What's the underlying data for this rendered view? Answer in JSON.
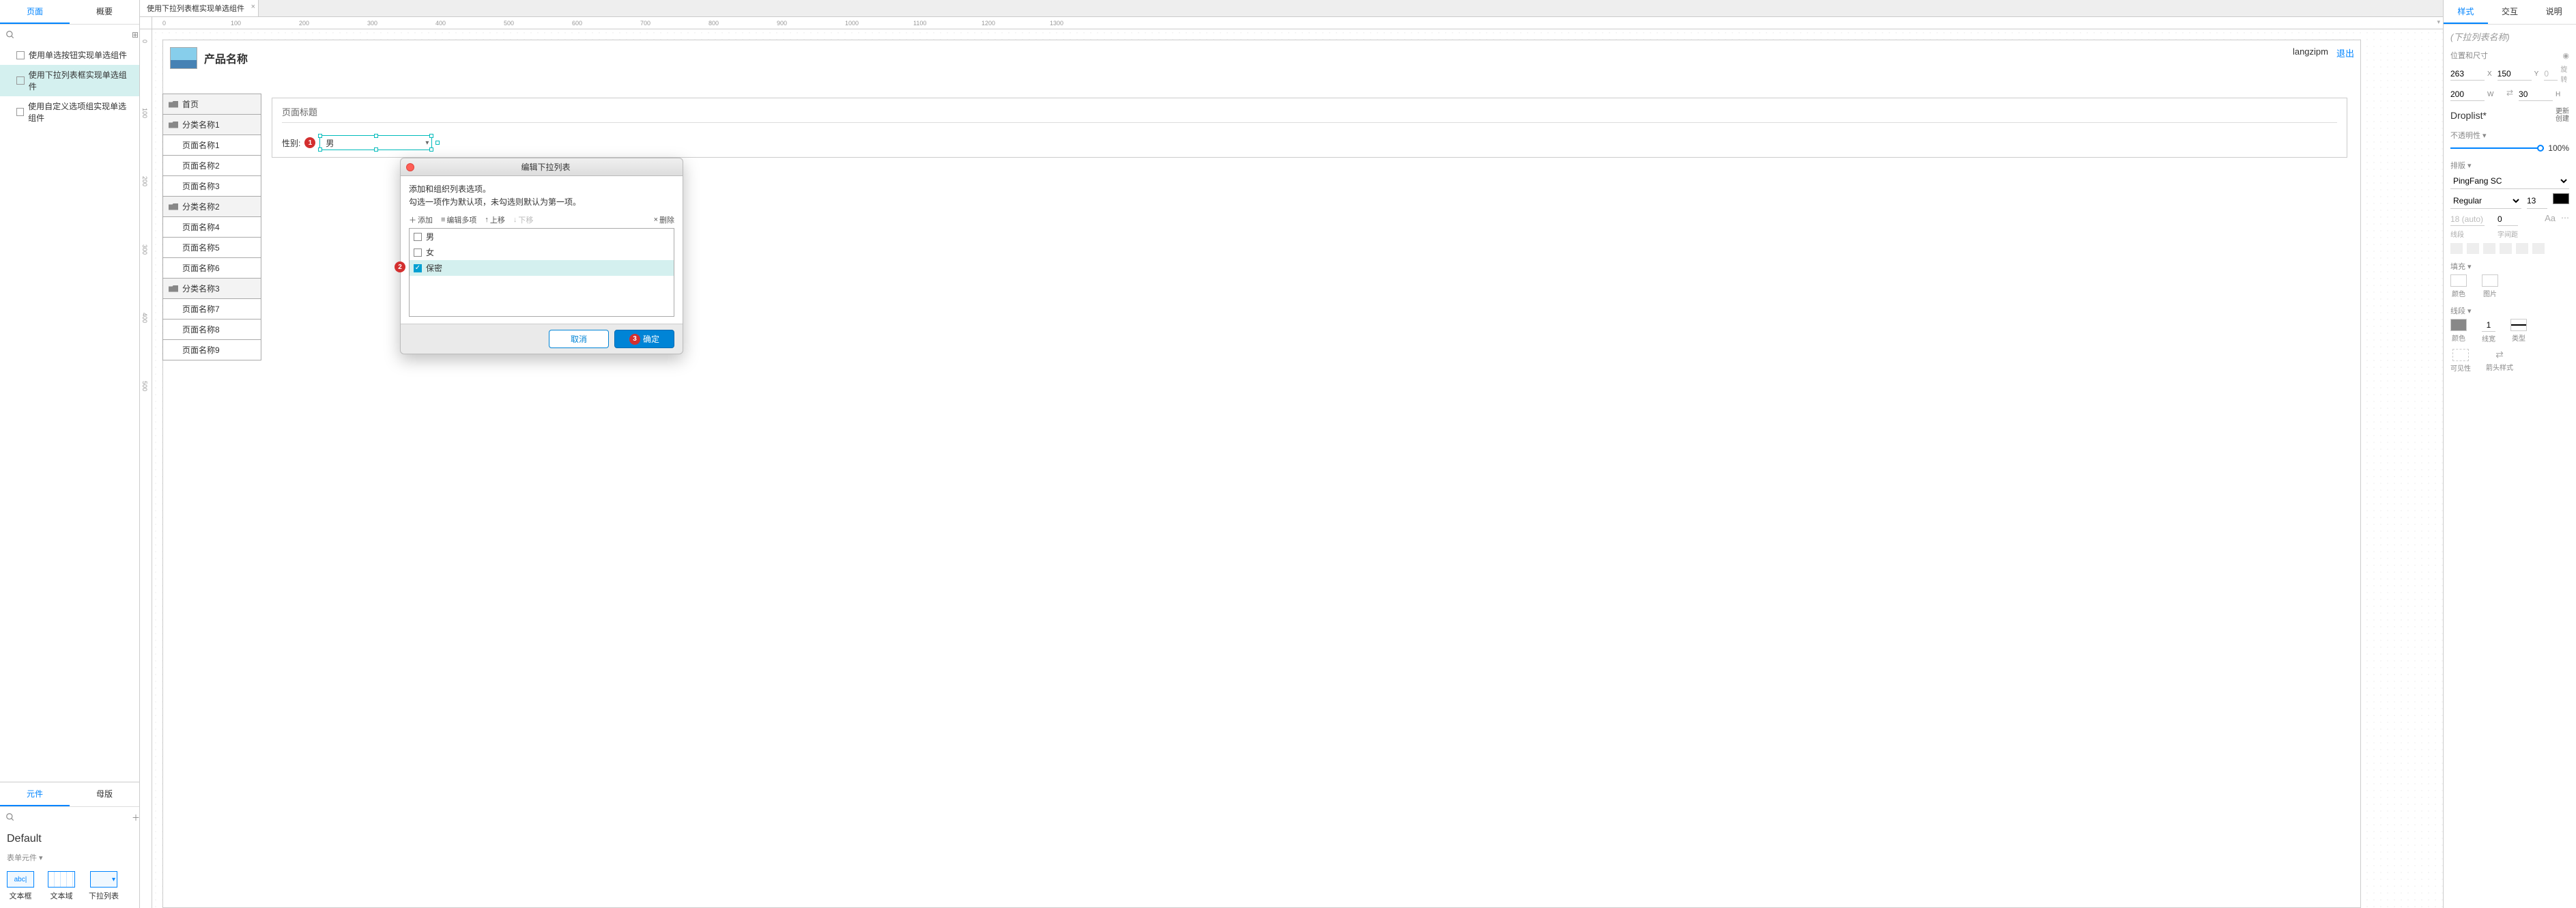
{
  "leftPanel": {
    "tabs": {
      "pages": "页面",
      "overview": "概要"
    },
    "tree": [
      {
        "label": "使用单选按钮实现单选组件",
        "selected": false
      },
      {
        "label": "使用下拉列表框实现单选组件",
        "selected": true
      },
      {
        "label": "使用自定义选项组实现单选组件",
        "selected": false
      }
    ]
  },
  "libPanel": {
    "tabs": {
      "widgets": "元件",
      "masters": "母版"
    },
    "defaultLabel": "Default",
    "categoryLabel": "表单元件 ▾",
    "widgets": [
      {
        "label": "文本框",
        "kind": "text"
      },
      {
        "label": "文本域",
        "kind": "grid"
      },
      {
        "label": "下拉列表",
        "kind": "drop"
      }
    ]
  },
  "centerTab": {
    "label": "使用下拉列表框实现单选组件"
  },
  "rulerH": [
    0,
    100,
    200,
    300,
    400,
    500,
    600,
    700,
    800,
    900,
    1000,
    1100,
    1200,
    1300
  ],
  "rulerV": [
    0,
    100,
    200,
    300,
    400,
    500
  ],
  "design": {
    "productTitle": "产品名称",
    "username": "langzipm",
    "logout": "退出",
    "sitemap": [
      {
        "label": "首页",
        "type": "cat"
      },
      {
        "label": "分类名称1",
        "type": "cat"
      },
      {
        "label": "页面名称1",
        "type": "sub"
      },
      {
        "label": "页面名称2",
        "type": "sub"
      },
      {
        "label": "页面名称3",
        "type": "sub"
      },
      {
        "label": "分类名称2",
        "type": "cat"
      },
      {
        "label": "页面名称4",
        "type": "sub"
      },
      {
        "label": "页面名称5",
        "type": "sub"
      },
      {
        "label": "页面名称6",
        "type": "sub"
      },
      {
        "label": "分类名称3",
        "type": "cat"
      },
      {
        "label": "页面名称7",
        "type": "sub"
      },
      {
        "label": "页面名称8",
        "type": "sub"
      },
      {
        "label": "页面名称9",
        "type": "sub"
      }
    ],
    "pageTitle": "页面标题",
    "fieldLabel": "性别:",
    "badge1": "1",
    "droplistValue": "男"
  },
  "dialog": {
    "title": "编辑下拉列表",
    "desc1": "添加和组织列表选项。",
    "desc2": "勾选一项作为默认项，未勾选则默认为第一项。",
    "tools": {
      "add": "添加",
      "editMany": "编辑多项",
      "up": "上移",
      "down": "下移",
      "del": "删除"
    },
    "items": [
      {
        "label": "男",
        "checked": false
      },
      {
        "label": "女",
        "checked": false
      },
      {
        "label": "保密",
        "checked": true,
        "selected": true
      }
    ],
    "badge2": "2",
    "cancel": "取消",
    "ok": "确定",
    "badge3": "3"
  },
  "rightPanel": {
    "tabs": {
      "style": "样式",
      "interact": "交互",
      "notes": "说明"
    },
    "namePlaceholder": "(下拉列表名称)",
    "posSizeLabel": "位置和尺寸",
    "x": "263",
    "xUnit": "X",
    "y": "150",
    "yUnit": "Y",
    "rotate": "0",
    "rotateUnit": "",
    "w": "200",
    "wUnit": "W",
    "h": "30",
    "hUnit": "H",
    "widgetType": "Droplist*",
    "updateCreate1": "更新",
    "updateCreate2": "创建",
    "opacityLabel": "不透明性 ▾",
    "opacityVal": "100%",
    "typographyLabel": "排版 ▾",
    "font": "PingFang SC",
    "weight": "Regular",
    "fontSize": "13",
    "lineHeight": "18 (auto)",
    "letterSpacing": "0",
    "lineHeightLabel": "线段",
    "letterSpacingLabel": "字间距",
    "fillLabel": "填充 ▾",
    "fillColor": "颜色",
    "fillImage": "图片",
    "strokeLabel": "线段 ▾",
    "strokeColor": "颜色",
    "strokeWidth": "1",
    "strokeWidthLabel": "线宽",
    "strokeType": "类型",
    "visibility": "可见性",
    "arrowStyle": "箭头样式"
  }
}
